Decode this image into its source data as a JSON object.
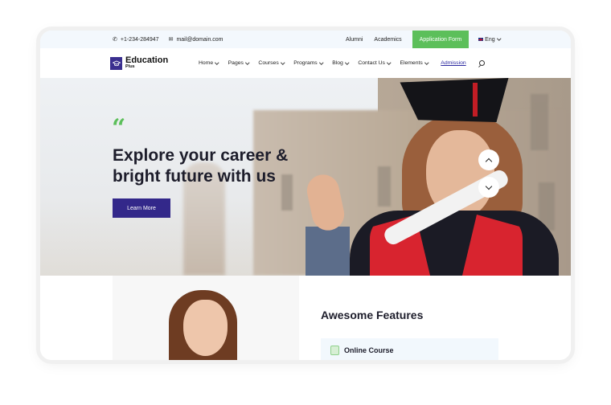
{
  "topbar": {
    "phone": "+1-234-284947",
    "email": "mail@domain.com",
    "links": [
      "Alumni",
      "Academics"
    ],
    "application_button": "Application Form",
    "language": "Eng"
  },
  "brand": {
    "name": "Education",
    "subtitle": "Plus",
    "color": "#3a2f8f"
  },
  "nav": {
    "items": [
      {
        "label": "Home"
      },
      {
        "label": "Pages"
      },
      {
        "label": "Courses"
      },
      {
        "label": "Programs"
      },
      {
        "label": "Blog"
      },
      {
        "label": "Contact Us"
      },
      {
        "label": "Elements"
      }
    ],
    "admission": "Admission"
  },
  "hero": {
    "quote_mark": "“",
    "headline": "Explore your career & bright future with us",
    "cta": "Learn More",
    "accent_color": "#5cbf5a",
    "cta_color": "#33288a"
  },
  "features": {
    "title": "Awesome Features",
    "items": [
      {
        "label": "Online Course"
      }
    ]
  }
}
